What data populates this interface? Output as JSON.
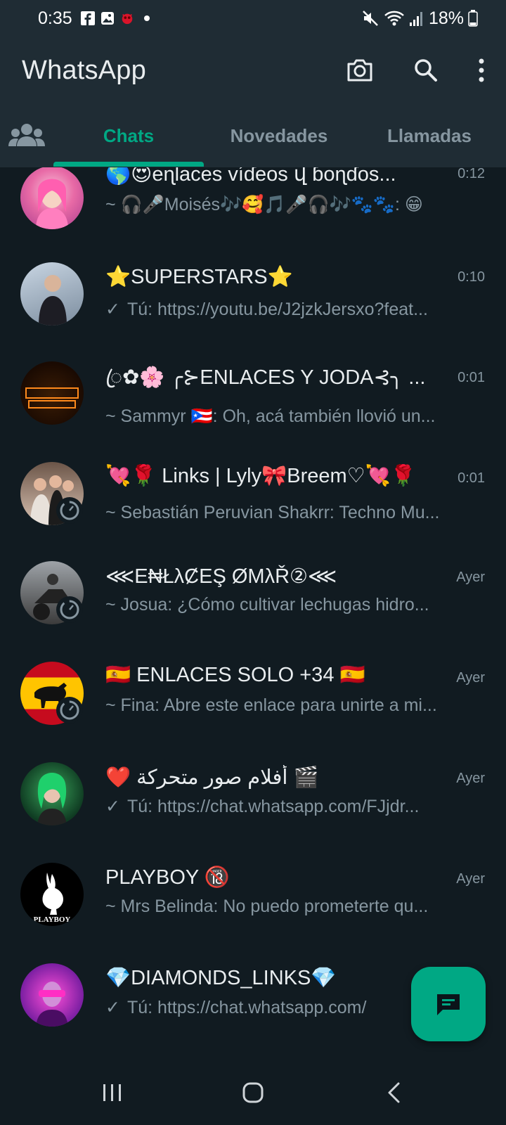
{
  "status_bar": {
    "time": "0:35",
    "battery": "18%"
  },
  "header": {
    "title": "WhatsApp"
  },
  "tabs": [
    {
      "label": "Chats",
      "active": true
    },
    {
      "label": "Novedades",
      "active": false
    },
    {
      "label": "Llamadas",
      "active": false
    }
  ],
  "chats": [
    {
      "name": "🌎😍eɳlaces víɗeos վ ɓoɳɗos...",
      "time": "0:12",
      "preview": "~ 🎧🎤Moisés🎶🥰🎵🎤🎧🎶🐾🐾: 😁",
      "sent": false,
      "status": false
    },
    {
      "name": "⭐SUPERSTARS⭐",
      "time": "0:10",
      "preview": "Tú: https://youtu.be/J2jzkJersxo?feat...",
      "sent": true,
      "status": false
    },
    {
      "name": "ꦿ✿🌸 ╭⊱ENLACES Y JODA⊰╮ ...",
      "time": "0:01",
      "preview": "~ Sammyr 🇵🇷: Oh, acá también llovió un...",
      "sent": false,
      "status": false
    },
    {
      "name": "💘🌹 Links | Lyly🎀Breem♡💘🌹",
      "time": "0:01",
      "preview": "~ Sebastián Peruvian Shakrr: Techno Mu...",
      "sent": false,
      "status": true
    },
    {
      "name": "⋘E₦ŁλȻEŞ ØMλŘ②⋘",
      "time": "Ayer",
      "preview": "~ Josua: ¿Cómo cultivar lechugas hidro...",
      "sent": false,
      "status": true
    },
    {
      "name": "🇪🇸 ENLACES SOLO +34 🇪🇸",
      "time": "Ayer",
      "preview": "~ Fina: Abre este enlace para unirte a mi...",
      "sent": false,
      "status": true
    },
    {
      "name": "❤️ أفلام صور متحركة 🎬",
      "time": "Ayer",
      "preview": "Tú: https://chat.whatsapp.com/FJjdr...",
      "sent": true,
      "status": false
    },
    {
      "name": "PLAYBOY 🔞",
      "time": "Ayer",
      "preview": "~ Mrs Belinda: No puedo prometerte qu...",
      "sent": false,
      "status": false
    },
    {
      "name": "💎DIAMONDS_LINKS💎",
      "time": "",
      "preview": "Tú: https://chat.whatsapp.com/",
      "sent": true,
      "status": false
    }
  ],
  "icons": {
    "camera": "camera-icon",
    "search": "search-icon",
    "menu": "more-vert-icon",
    "community": "community-icon",
    "fab": "new-chat-icon"
  },
  "colors": {
    "accent": "#00a884",
    "background": "#111b21",
    "header": "#1f2c34"
  }
}
